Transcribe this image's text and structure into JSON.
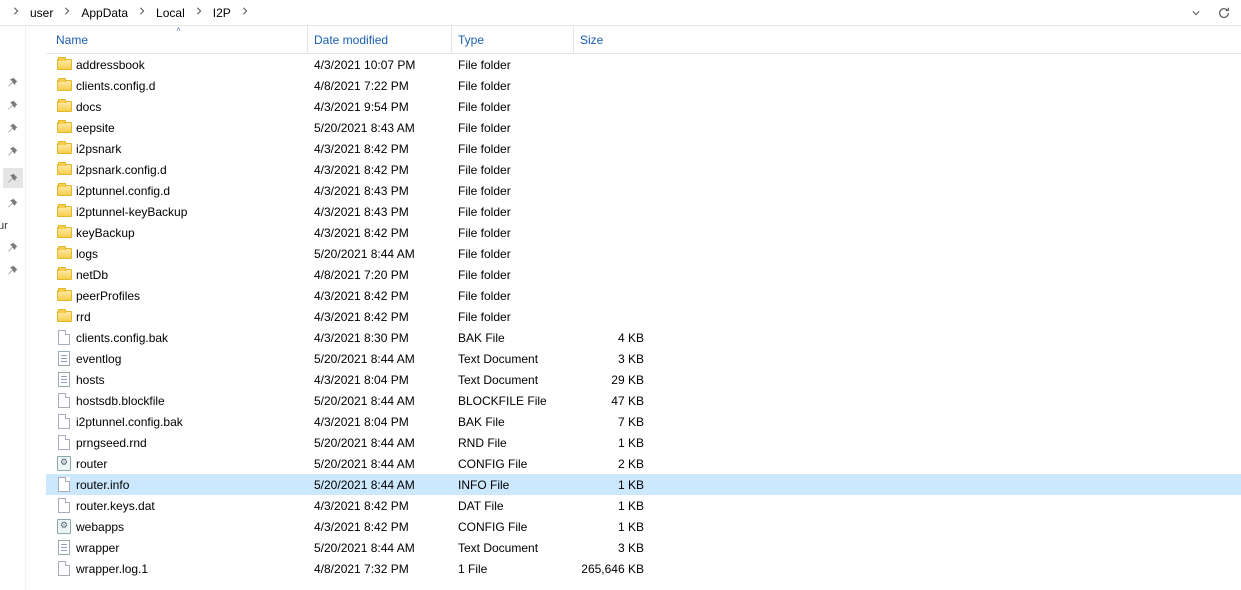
{
  "breadcrumb": [
    "user",
    "AppData",
    "Local",
    "I2P"
  ],
  "headers": {
    "name": "Name",
    "date": "Date modified",
    "type": "Type",
    "size": "Size"
  },
  "pin_strip_label": "ur",
  "files": [
    {
      "name": "addressbook",
      "date": "4/3/2021 10:07 PM",
      "type": "File folder",
      "size": "",
      "icon": "folder"
    },
    {
      "name": "clients.config.d",
      "date": "4/8/2021 7:22 PM",
      "type": "File folder",
      "size": "",
      "icon": "folder"
    },
    {
      "name": "docs",
      "date": "4/3/2021 9:54 PM",
      "type": "File folder",
      "size": "",
      "icon": "folder"
    },
    {
      "name": "eepsite",
      "date": "5/20/2021 8:43 AM",
      "type": "File folder",
      "size": "",
      "icon": "folder"
    },
    {
      "name": "i2psnark",
      "date": "4/3/2021 8:42 PM",
      "type": "File folder",
      "size": "",
      "icon": "folder"
    },
    {
      "name": "i2psnark.config.d",
      "date": "4/3/2021 8:42 PM",
      "type": "File folder",
      "size": "",
      "icon": "folder"
    },
    {
      "name": "i2ptunnel.config.d",
      "date": "4/3/2021 8:43 PM",
      "type": "File folder",
      "size": "",
      "icon": "folder"
    },
    {
      "name": "i2ptunnel-keyBackup",
      "date": "4/3/2021 8:43 PM",
      "type": "File folder",
      "size": "",
      "icon": "folder"
    },
    {
      "name": "keyBackup",
      "date": "4/3/2021 8:42 PM",
      "type": "File folder",
      "size": "",
      "icon": "folder"
    },
    {
      "name": "logs",
      "date": "5/20/2021 8:44 AM",
      "type": "File folder",
      "size": "",
      "icon": "folder"
    },
    {
      "name": "netDb",
      "date": "4/8/2021 7:20 PM",
      "type": "File folder",
      "size": "",
      "icon": "folder"
    },
    {
      "name": "peerProfiles",
      "date": "4/3/2021 8:42 PM",
      "type": "File folder",
      "size": "",
      "icon": "folder"
    },
    {
      "name": "rrd",
      "date": "4/3/2021 8:42 PM",
      "type": "File folder",
      "size": "",
      "icon": "folder"
    },
    {
      "name": "clients.config.bak",
      "date": "4/3/2021 8:30 PM",
      "type": "BAK File",
      "size": "4 KB",
      "icon": "file"
    },
    {
      "name": "eventlog",
      "date": "5/20/2021 8:44 AM",
      "type": "Text Document",
      "size": "3 KB",
      "icon": "text"
    },
    {
      "name": "hosts",
      "date": "4/3/2021 8:04 PM",
      "type": "Text Document",
      "size": "29 KB",
      "icon": "text"
    },
    {
      "name": "hostsdb.blockfile",
      "date": "5/20/2021 8:44 AM",
      "type": "BLOCKFILE File",
      "size": "47 KB",
      "icon": "file"
    },
    {
      "name": "i2ptunnel.config.bak",
      "date": "4/3/2021 8:04 PM",
      "type": "BAK File",
      "size": "7 KB",
      "icon": "file"
    },
    {
      "name": "prngseed.rnd",
      "date": "5/20/2021 8:44 AM",
      "type": "RND File",
      "size": "1 KB",
      "icon": "file"
    },
    {
      "name": "router",
      "date": "5/20/2021 8:44 AM",
      "type": "CONFIG File",
      "size": "2 KB",
      "icon": "config"
    },
    {
      "name": "router.info",
      "date": "5/20/2021 8:44 AM",
      "type": "INFO File",
      "size": "1 KB",
      "icon": "file",
      "selected": true
    },
    {
      "name": "router.keys.dat",
      "date": "4/3/2021 8:42 PM",
      "type": "DAT File",
      "size": "1 KB",
      "icon": "file"
    },
    {
      "name": "webapps",
      "date": "4/3/2021 8:42 PM",
      "type": "CONFIG File",
      "size": "1 KB",
      "icon": "config"
    },
    {
      "name": "wrapper",
      "date": "5/20/2021 8:44 AM",
      "type": "Text Document",
      "size": "3 KB",
      "icon": "text"
    },
    {
      "name": "wrapper.log.1",
      "date": "4/8/2021 7:32 PM",
      "type": "1 File",
      "size": "265,646 KB",
      "icon": "file"
    }
  ],
  "pins_count": 8,
  "pin_active_index": 4
}
